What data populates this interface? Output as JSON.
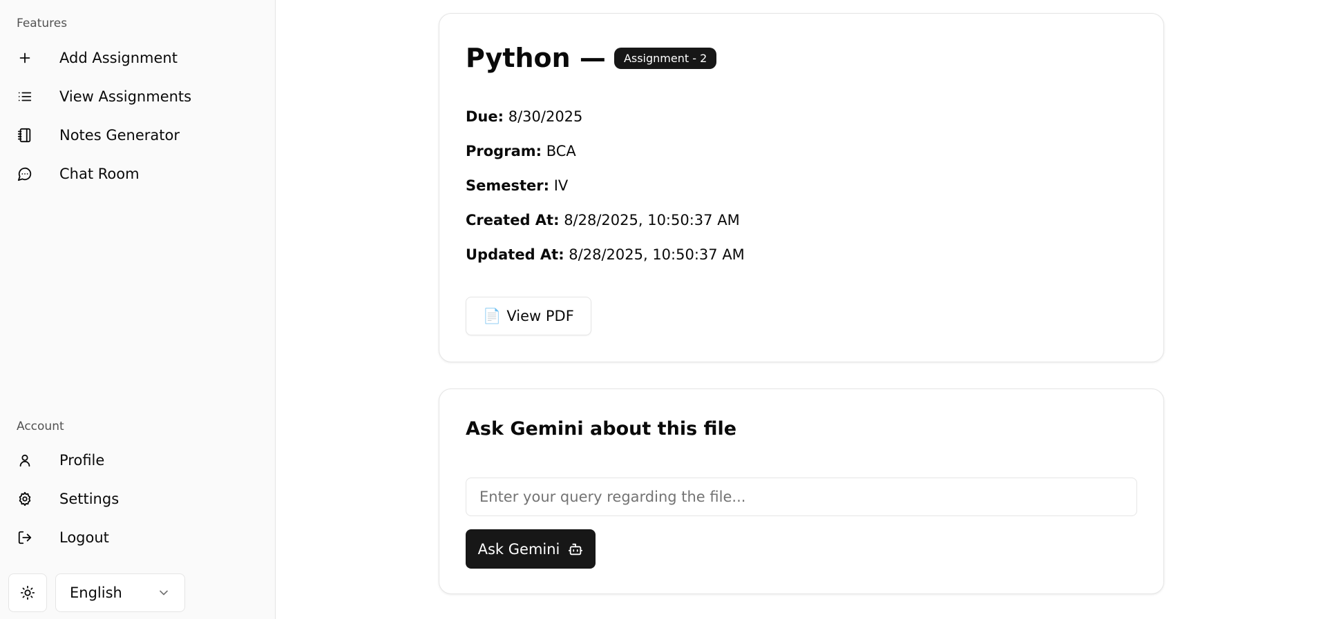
{
  "sidebar": {
    "features_label": "Features",
    "features": [
      {
        "label": "Add Assignment",
        "icon": "plus-icon"
      },
      {
        "label": "View Assignments",
        "icon": "list-icon"
      },
      {
        "label": "Notes Generator",
        "icon": "notebook-icon"
      },
      {
        "label": "Chat Room",
        "icon": "message-circle-icon"
      }
    ],
    "account_label": "Account",
    "account": [
      {
        "label": "Profile",
        "icon": "user-icon"
      },
      {
        "label": "Settings",
        "icon": "gear-icon"
      },
      {
        "label": "Logout",
        "icon": "logout-icon"
      }
    ],
    "theme_icon": "sun-icon",
    "language": "English"
  },
  "assignment": {
    "subject": "Python —",
    "badge": "Assignment - 2",
    "due_label": "Due:",
    "due": "8/30/2025",
    "program_label": "Program:",
    "program": "BCA",
    "semester_label": "Semester:",
    "semester": "IV",
    "created_label": "Created At:",
    "created": "8/28/2025, 10:50:37 AM",
    "updated_label": "Updated At:",
    "updated": "8/28/2025, 10:50:37 AM",
    "pdf_button": "View PDF",
    "pdf_icon": "📄"
  },
  "gemini": {
    "title": "Ask Gemini about this file",
    "placeholder": "Enter your query regarding the file...",
    "value": "",
    "button": "Ask Gemini",
    "button_icon": "bot-icon"
  }
}
